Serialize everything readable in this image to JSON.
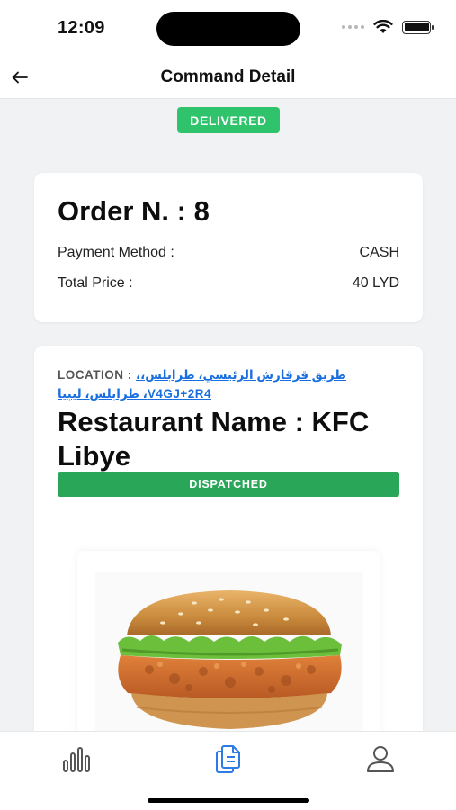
{
  "status_bar": {
    "time": "12:09"
  },
  "header": {
    "title": "Command Detail",
    "back_icon": "arrow-left-icon"
  },
  "order": {
    "status_badge": "DELIVERED",
    "title": "Order N. : 8",
    "payment_label": "Payment Method :",
    "payment_value": "CASH",
    "total_label": "Total Price :",
    "total_value": "40 LYD"
  },
  "restaurant": {
    "location_label": "LOCATION : ",
    "location_text": "طريق قرقارش الرئيسي، طرابلس،، V4GJ+2R4، طرابلس، ليبيا",
    "name": "Restaurant Name : KFC Libye",
    "status": "DISPATCHED",
    "product_image": "burger-image"
  },
  "tab_bar": {
    "items": [
      {
        "icon": "bar-chart-icon",
        "active": false
      },
      {
        "icon": "documents-icon",
        "active": true
      },
      {
        "icon": "user-icon",
        "active": false
      }
    ]
  },
  "colors": {
    "delivered": "#2fc46b",
    "dispatched": "#2aa659",
    "link": "#1a6fe0",
    "tab_active": "#2d7be5",
    "tab_inactive": "#555555"
  }
}
